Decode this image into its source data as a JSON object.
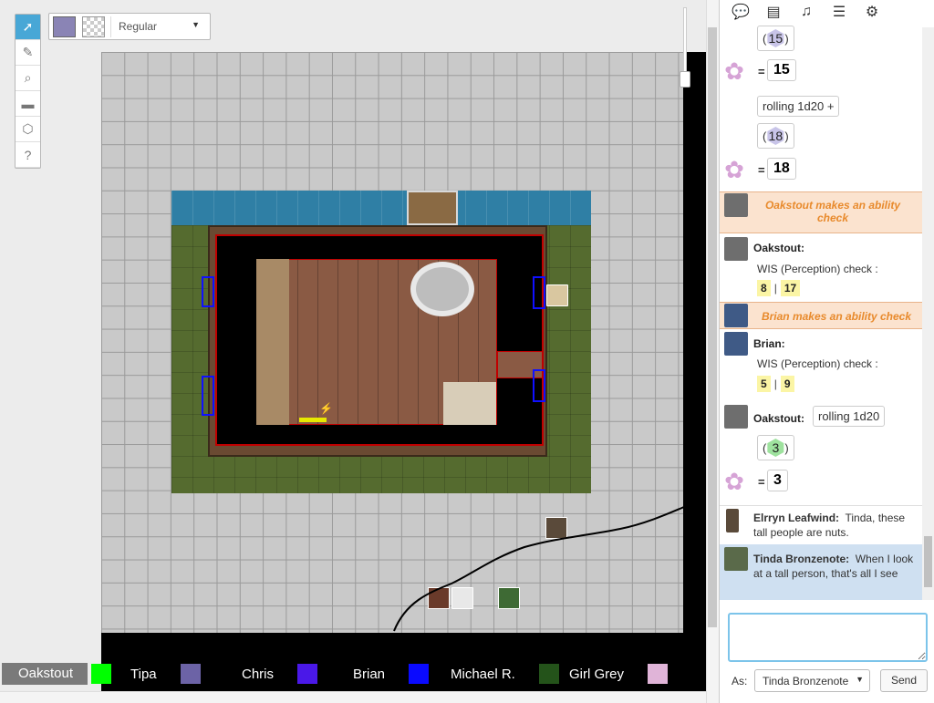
{
  "toolbar": {
    "tools": [
      {
        "name": "select-tool",
        "icon": "cursor-icon",
        "glyph": "➚"
      },
      {
        "name": "draw-tool",
        "icon": "brush-icon",
        "glyph": "✎"
      },
      {
        "name": "zoom-tool",
        "icon": "magnifier-icon",
        "glyph": "⌕"
      },
      {
        "name": "measure-tool",
        "icon": "ruler-icon",
        "glyph": "▬"
      },
      {
        "name": "fog-tool",
        "icon": "d20-icon",
        "glyph": "⬡"
      },
      {
        "name": "help-tool",
        "icon": "help-icon",
        "glyph": "?"
      }
    ],
    "fill_color": "#8a84b5",
    "font_style": "Regular"
  },
  "players": [
    {
      "name": "Oakstout",
      "color": "#00ff00",
      "self": true
    },
    {
      "name": "Tipa",
      "color": "#6c63a6"
    },
    {
      "name": "Chris",
      "color": "#4a18e8"
    },
    {
      "name": "Brian",
      "color": "#0a0aff"
    },
    {
      "name": "Michael R.",
      "color": "#24531a"
    },
    {
      "name": "Girl Grey",
      "color": "#e0b4d8"
    }
  ],
  "sidebar": {
    "tabs": [
      "chat-icon",
      "journal-icon",
      "compendium-icon",
      "list-icon",
      "gear-icon"
    ]
  },
  "chat": {
    "roll1_result_die": "15",
    "roll1_total": "15",
    "roll2_formula": "rolling 1d20 +",
    "roll2_die": "18",
    "roll2_total": "18",
    "oak_banner": "Oakstout makes an ability check",
    "oak_speaker": "Oakstout:",
    "oak_check": "WIS (Perception) check :",
    "oak_v1": "8",
    "oak_v2": "17",
    "brian_banner": "Brian makes an ability check",
    "brian_speaker": "Brian:",
    "brian_check": "WIS (Perception) check :",
    "brian_v1": "5",
    "brian_v2": "9",
    "oak2_speaker": "Oakstout:",
    "oak2_formula": "rolling 1d20",
    "oak2_die": "3",
    "oak2_total": "3",
    "elrryn_speaker": "Elrryn Leafwind:",
    "elrryn_text": "Tinda, these tall people are nuts.",
    "tinda_speaker": "Tinda Bronzenote:",
    "tinda_text": "When I look at a tall person, that's all I see",
    "equals": "=",
    "bar_sep": "|",
    "open_paren": "(",
    "close_paren": ")",
    "as_label": "As:",
    "as_value": "Tinda Bronzenote",
    "send_label": "Send",
    "input_value": ""
  }
}
